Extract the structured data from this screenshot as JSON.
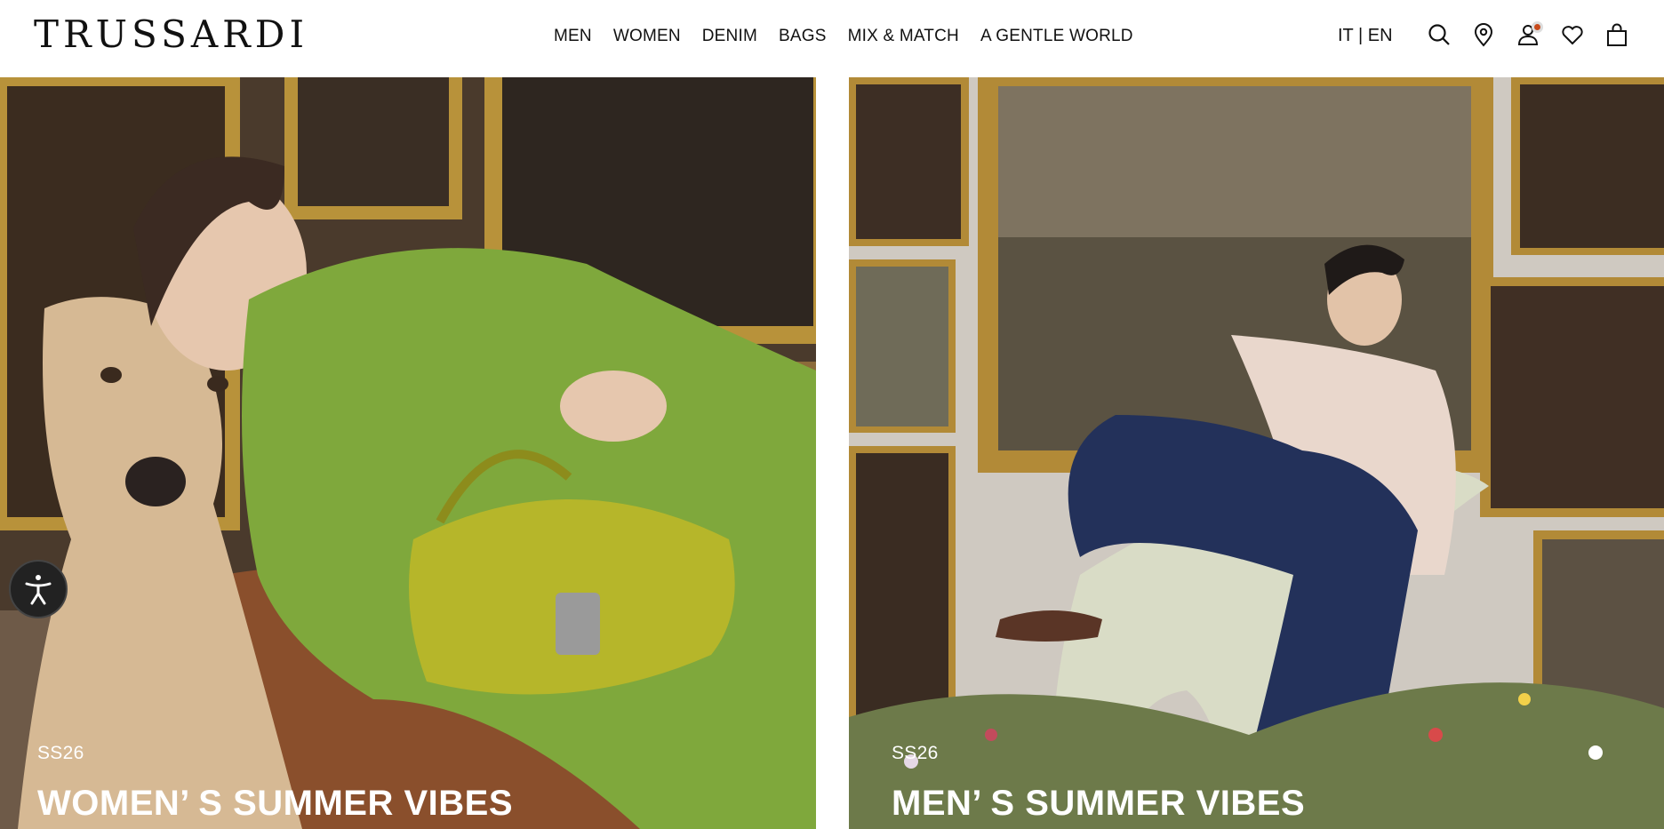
{
  "header": {
    "logo": "TRUSSARDI",
    "nav": [
      "MEN",
      "WOMEN",
      "DENIM",
      "BAGS",
      "MIX & MATCH",
      "A GENTLE WORLD"
    ],
    "lang_it": "IT",
    "lang_sep": "|",
    "lang_en": "EN",
    "icons": [
      "search-icon",
      "store-locator-icon",
      "account-icon",
      "wishlist-icon",
      "bag-icon"
    ]
  },
  "hero_left": {
    "season": "SS26",
    "title": "WOMEN’ S SUMMER VIBES"
  },
  "hero_right": {
    "season": "SS26",
    "title": "MEN’ S SUMMER VIBES"
  },
  "accessibility": {
    "icon": "accessibility-icon"
  },
  "colors": {
    "notification_dot": "#c84a1c",
    "text_on_image": "#ffffff"
  }
}
